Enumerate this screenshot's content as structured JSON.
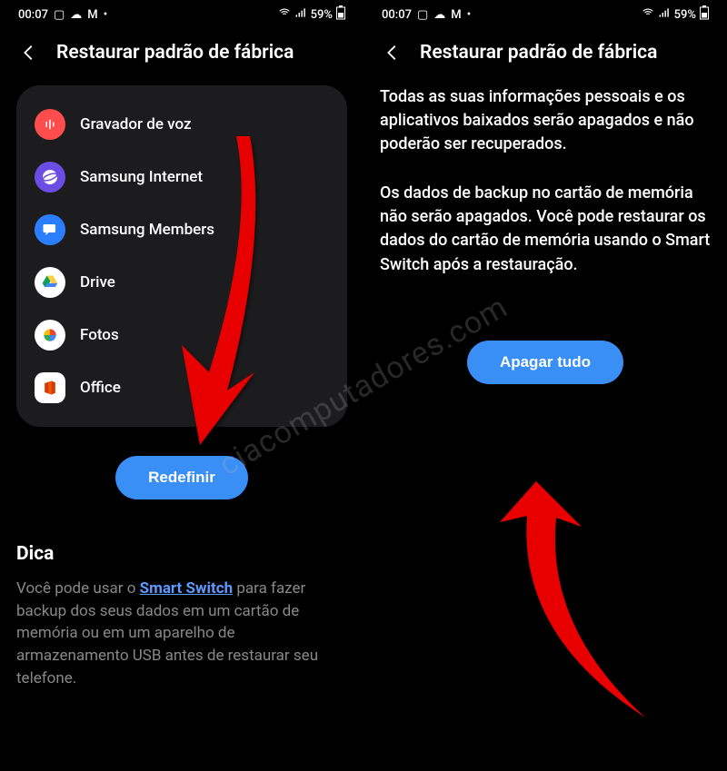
{
  "statusbar": {
    "time": "00:07",
    "battery_text": "59%"
  },
  "left": {
    "title": "Restaurar padrão de fábrica",
    "apps": [
      {
        "label": "Gravador de voz",
        "icon": "gravador"
      },
      {
        "label": "Samsung Internet",
        "icon": "internet"
      },
      {
        "label": "Samsung Members",
        "icon": "members"
      },
      {
        "label": "Drive",
        "icon": "drive"
      },
      {
        "label": "Fotos",
        "icon": "fotos"
      },
      {
        "label": "Office",
        "icon": "office"
      }
    ],
    "button": "Redefinir",
    "tip_title": "Dica",
    "tip_before": "Você pode usar o ",
    "tip_link": "Smart Switch",
    "tip_after": " para fazer backup dos seus dados em um cartão de memória ou em um aparelho de armazenamento USB antes de restaurar seu telefone."
  },
  "right": {
    "title": "Restaurar padrão de fábrica",
    "para1": "Todas as suas informações pessoais e os aplicativos baixados serão apagados e não poderão ser recuperados.",
    "para2": "Os dados de backup no cartão de memória não serão apagados. Você pode restaurar os dados do cartão de memória usando o Smart Switch após a restauração.",
    "button": "Apagar tudo"
  },
  "watermark": "ciacomputadores.com"
}
